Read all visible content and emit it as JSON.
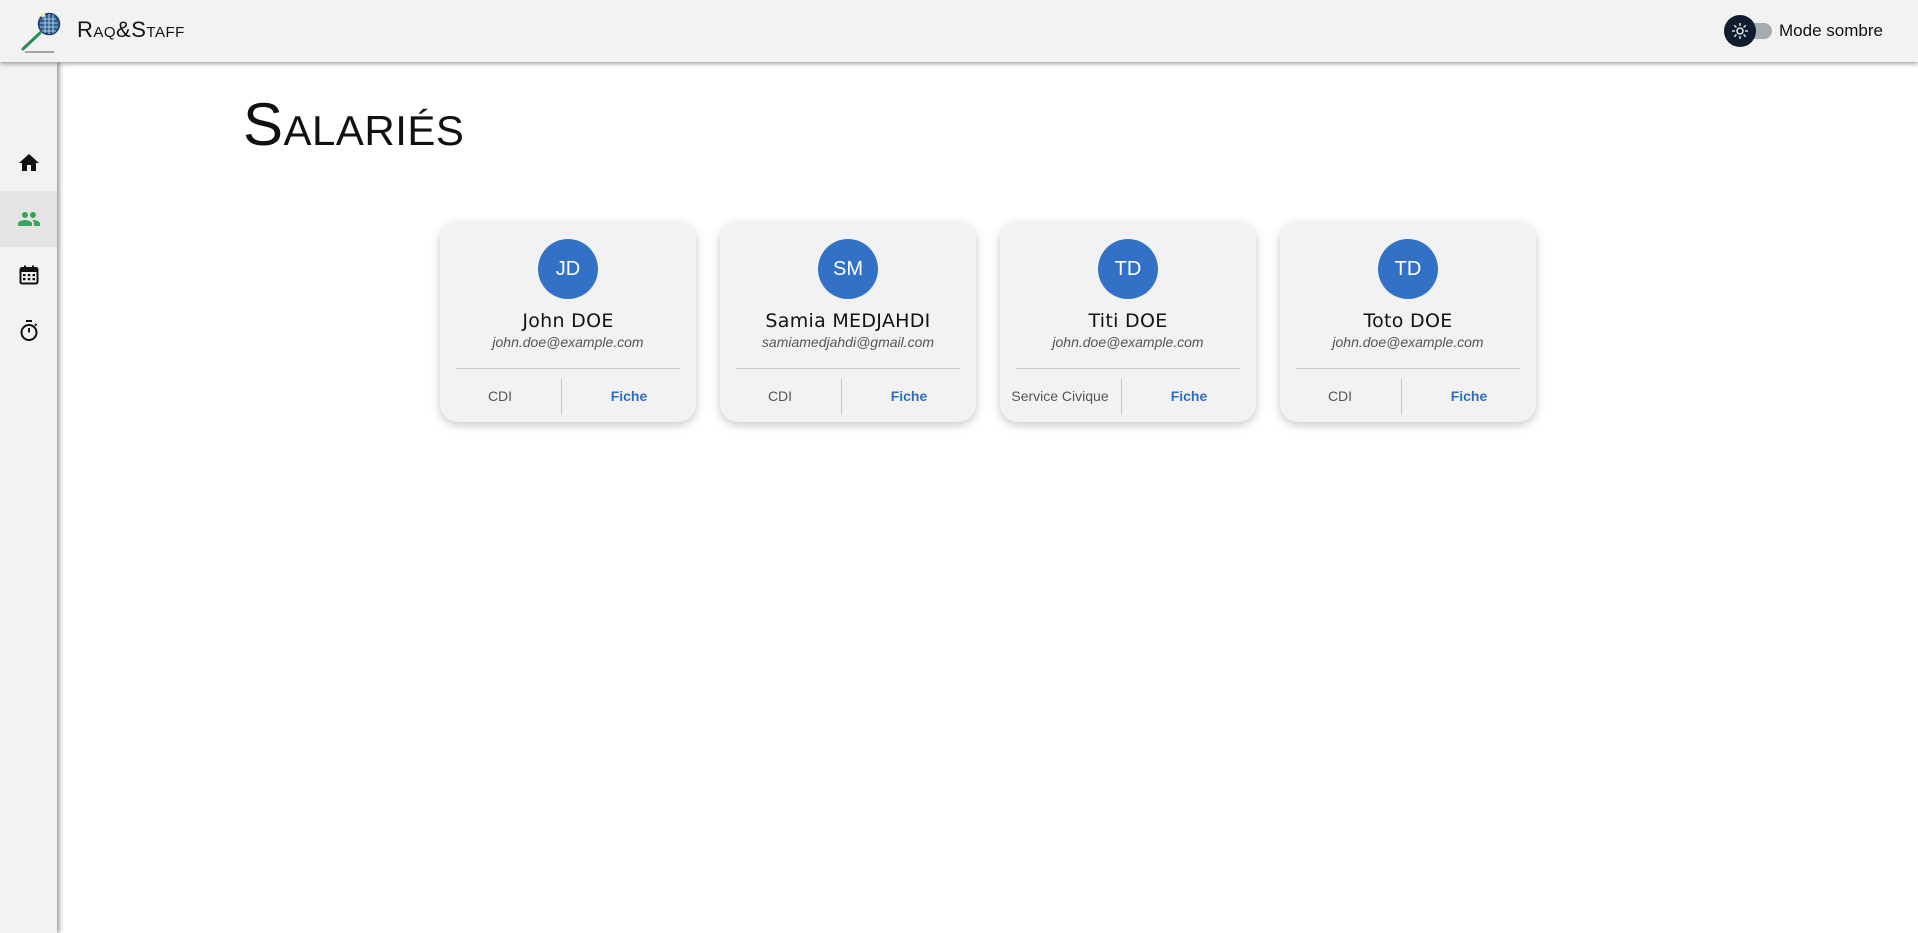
{
  "header": {
    "brand": "Raq&Staff",
    "theme_label": "Mode sombre",
    "dark_mode": false
  },
  "sidebar": {
    "items": [
      {
        "name": "home",
        "icon": "home-icon",
        "active": false
      },
      {
        "name": "employees",
        "icon": "people-icon",
        "active": true
      },
      {
        "name": "calendar",
        "icon": "calendar-icon",
        "active": false
      },
      {
        "name": "timer",
        "icon": "timer-icon",
        "active": false
      }
    ]
  },
  "page": {
    "title": "Salariés"
  },
  "employees": [
    {
      "initials": "JD",
      "name": "John DOE",
      "email": "john.doe@example.com",
      "contract": "CDI",
      "action": "Fiche"
    },
    {
      "initials": "SM",
      "name": "Samia MEDJAHDI",
      "email": "samiamedjahdi@gmail.com",
      "contract": "CDI",
      "action": "Fiche"
    },
    {
      "initials": "TD",
      "name": "Titi DOE",
      "email": "john.doe@example.com",
      "contract": "Service Civique",
      "action": "Fiche"
    },
    {
      "initials": "TD",
      "name": "Toto DOE",
      "email": "john.doe@example.com",
      "contract": "CDI",
      "action": "Fiche"
    }
  ],
  "colors": {
    "accent": "#3371c6",
    "link": "#2f6fc0",
    "active_icon": "#3aa35a",
    "surface": "#f2f2f2"
  }
}
